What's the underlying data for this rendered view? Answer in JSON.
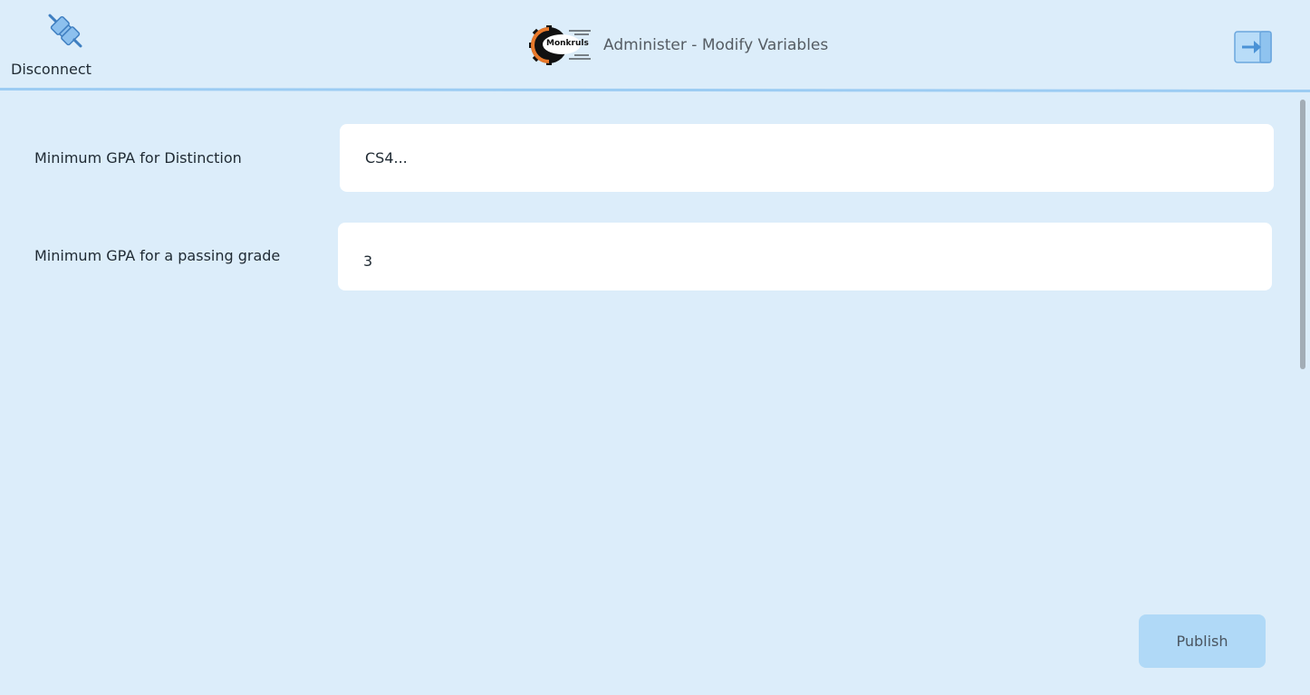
{
  "header": {
    "disconnect_label": "Disconnect",
    "disconnect_icon": "plug-icon",
    "logo_text": "Monkruls",
    "title": "Administer - Modify Variables",
    "exit_icon": "exit-arrow-icon"
  },
  "fields": [
    {
      "label": "Minimum GPA for Distinction",
      "value": "CS4..."
    },
    {
      "label": "Minimum GPA for a passing grade",
      "value": "3"
    }
  ],
  "actions": {
    "publish_label": "Publish"
  },
  "colors": {
    "background": "#dcedfa",
    "header_line": "#9cccf3",
    "field_background": "#ffffff",
    "publish_button": "#b0d9f7",
    "icon_blue": "#7fb6e8"
  }
}
